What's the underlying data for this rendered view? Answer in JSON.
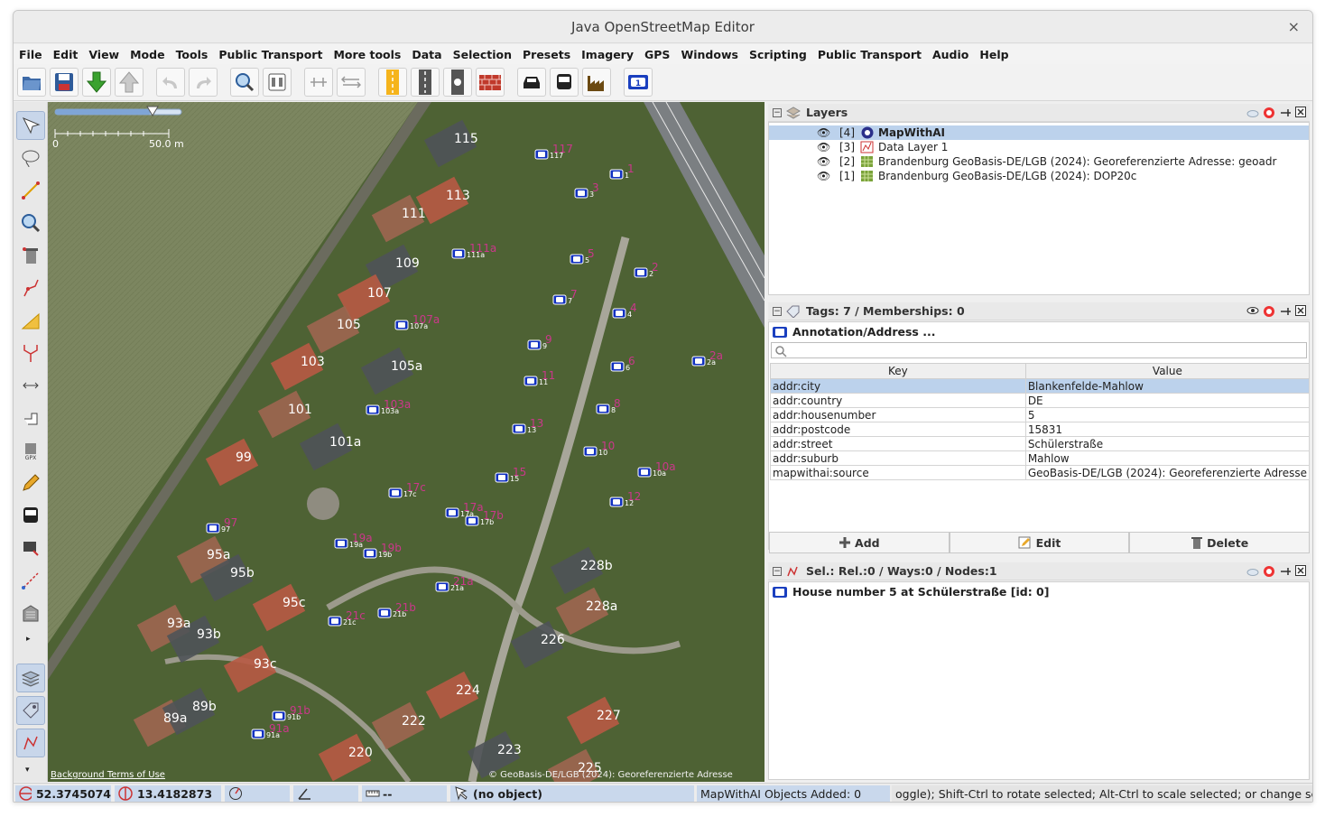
{
  "window": {
    "title": "Java OpenStreetMap Editor",
    "close": "×"
  },
  "menu": [
    "File",
    "Edit",
    "View",
    "Mode",
    "Tools",
    "Public Transport",
    "More tools",
    "Data",
    "Selection",
    "Presets",
    "Imagery",
    "GPS",
    "Windows",
    "Scripting",
    "Public Transport",
    "Audio",
    "Help"
  ],
  "toolbar_icons": [
    "open-file-icon",
    "save-icon",
    "download-icon",
    "upload-icon",
    "undo-icon",
    "redo-icon",
    "zoom-icon",
    "preferences-icon",
    "combine-way-icon",
    "split-way-icon",
    "road-yellow-icon",
    "road-grey-icon",
    "traffic-signal-icon",
    "wall-icon",
    "car-icon",
    "bus-icon",
    "factory-icon",
    "annotation-id-icon"
  ],
  "left_tools": [
    "select-tool",
    "lasso-tool",
    "draw-tool",
    "zoom-tool",
    "delete-tool",
    "improve-way-tool",
    "area-tool",
    "split-tool",
    "parallel-tool",
    "extrude-tool",
    "gpx-tool",
    "pencil-tool",
    "bus-tool",
    "public-transport-tool",
    "measure-tool",
    "building-tool"
  ],
  "map": {
    "scale_min": "0",
    "scale_max": "50.0 m",
    "attribution_left": "Background Terms of Use",
    "attribution_right": "© GeoBasis-DE/LGB (2024): Georeferenzierte Adresse",
    "house_labels": [
      {
        "t": "115"
      },
      {
        "t": "113"
      },
      {
        "t": "111"
      },
      {
        "t": "109"
      },
      {
        "t": "107"
      },
      {
        "t": "105"
      },
      {
        "t": "105a"
      },
      {
        "t": "103"
      },
      {
        "t": "101"
      },
      {
        "t": "101a"
      },
      {
        "t": "99"
      },
      {
        "t": "95a"
      },
      {
        "t": "95b"
      },
      {
        "t": "95c"
      },
      {
        "t": "93a"
      },
      {
        "t": "93b"
      },
      {
        "t": "93c"
      },
      {
        "t": "89a"
      },
      {
        "t": "89b"
      },
      {
        "t": "220"
      },
      {
        "t": "222"
      },
      {
        "t": "223"
      },
      {
        "t": "224"
      },
      {
        "t": "225"
      },
      {
        "t": "226"
      },
      {
        "t": "227"
      },
      {
        "t": "228a"
      },
      {
        "t": "228b"
      }
    ],
    "markers": [
      "117",
      "1",
      "3",
      "111a",
      "5",
      "2",
      "7",
      "107a",
      "4",
      "9",
      "6",
      "2a",
      "11",
      "103a",
      "8",
      "13",
      "10",
      "15",
      "17c",
      "10a",
      "12",
      "17a",
      "17b",
      "97",
      "19a",
      "19b",
      "21a",
      "21c",
      "21b",
      "91b",
      "91a"
    ]
  },
  "layers": {
    "title": "Layers",
    "items": [
      {
        "num": "[4]",
        "name": "MapWithAI",
        "selected": true
      },
      {
        "num": "[3]",
        "name": "Data Layer 1",
        "selected": false
      },
      {
        "num": "[2]",
        "name": "Brandenburg GeoBasis-DE/LGB (2024): Georeferenzierte Adresse: geoadr",
        "selected": false
      },
      {
        "num": "[1]",
        "name": "Brandenburg GeoBasis-DE/LGB (2024): DOP20c",
        "selected": false
      }
    ]
  },
  "tags": {
    "title": "Tags: 7 / Memberships: 0",
    "object": "Annotation/Address ...",
    "search_placeholder": "",
    "key_header": "Key",
    "value_header": "Value",
    "rows": [
      {
        "k": "addr:city",
        "v": "Blankenfelde-Mahlow"
      },
      {
        "k": "addr:country",
        "v": "DE"
      },
      {
        "k": "addr:housenumber",
        "v": "5"
      },
      {
        "k": "addr:postcode",
        "v": "15831"
      },
      {
        "k": "addr:street",
        "v": "Schülerstraße"
      },
      {
        "k": "addr:suburb",
        "v": "Mahlow"
      },
      {
        "k": "mapwithai:source",
        "v": "GeoBasis-DE/LGB (2024): Georeferenzierte Adresse"
      }
    ],
    "add": "Add",
    "edit": "Edit",
    "delete": "Delete"
  },
  "selection": {
    "title": "Sel.: Rel.:0 / Ways:0 / Nodes:1",
    "item": "House number 5 at Schülerstraße [id: 0]"
  },
  "status": {
    "lat": "52.3745074",
    "lon": "13.4182873",
    "heading": "",
    "angle": "",
    "length": "--",
    "object": "(no object)",
    "mapwithai": "MapWithAI Objects Added: 0",
    "hint": "oggle); Shift-Ctrl to rotate selected; Alt-Ctrl to scale selected; or change selection"
  },
  "colors": {
    "selection": "#bcd2ec",
    "status_cell": "#c9d8ec",
    "marker_blue": "#1030c0",
    "label_magenta": "#e0309a"
  }
}
